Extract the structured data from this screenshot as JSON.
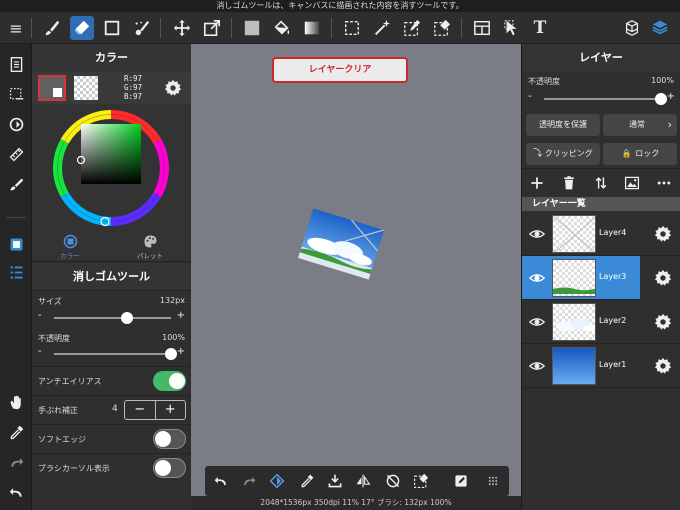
{
  "status_message": "消しゴムツールは、キャンバスに描画された内容を消すツールです。",
  "toolbar": {
    "items": [
      "menu-icon",
      "brush-icon",
      "eraser-icon",
      "rectangle-icon",
      "magic-brush-icon",
      "move-icon",
      "transform-icon",
      "fill-color-icon",
      "bucket-icon",
      "gradient-icon",
      "selection-icon",
      "magic-wand-icon",
      "select-pen-icon",
      "select-eraser-icon",
      "frame-divider-icon",
      "operation-icon",
      "text-icon",
      "material-icon",
      "layers-icon"
    ],
    "active": "eraser-icon",
    "text_tool_glyph": "T",
    "menu_glyph": "≡"
  },
  "color_panel": {
    "title": "カラー",
    "rgb": {
      "r": "R:97",
      "g": "G:97",
      "b": "B:97"
    },
    "main_color": "#616161",
    "tabs": [
      {
        "label": "カラー",
        "active": true
      },
      {
        "label": "パレット",
        "active": false
      }
    ]
  },
  "tool_panel": {
    "title": "消しゴムツール",
    "size_label": "サイズ",
    "size_value": "132px",
    "size_fraction": 0.62,
    "opacity_label": "不透明度",
    "opacity_value": "100%",
    "opacity_fraction": 1.0,
    "antialias_label": "アンチエイリアス",
    "antialias_on": true,
    "stabilizer_label": "手ぶれ補正",
    "stabilizer_value": "4",
    "stepper_minus": "−",
    "stepper_plus": "+",
    "soft_edge_label": "ソフトエッジ",
    "soft_edge_on": false,
    "cursor_label": "ブラシカーソル表示",
    "cursor_on": false,
    "minus": "-",
    "plus": "+"
  },
  "canvas": {
    "clear_button": "レイヤークリア",
    "status": "2048*1536px 350dpi 11% 17° ブラシ: 132px 100%"
  },
  "layer_panel": {
    "title": "レイヤー",
    "opacity_label": "不透明度",
    "opacity_value": "100%",
    "opacity_fraction": 1.0,
    "minus": "-",
    "plus": "+",
    "protect_alpha": "透明度を保護",
    "blend_mode": "通常",
    "clipping": "クリッピング",
    "lock": "ロック",
    "list_title": "レイヤー一覧",
    "layers": [
      {
        "name": "Layer4",
        "selected": false
      },
      {
        "name": "Layer3",
        "selected": true
      },
      {
        "name": "Layer2",
        "selected": false
      },
      {
        "name": "Layer1",
        "selected": false
      }
    ]
  },
  "colors": {
    "accent": "#3a8ad8",
    "clear_border": "#cc2a2a",
    "toggle_on": "#45b86a",
    "canvas_bg": "#7a7d85"
  }
}
